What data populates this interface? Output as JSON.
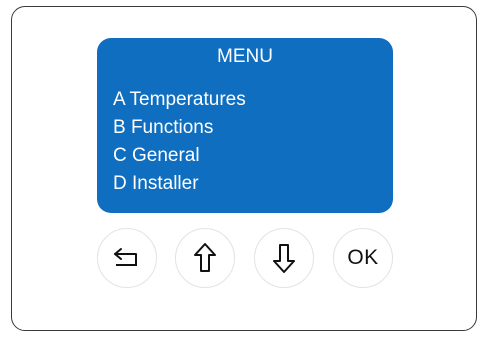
{
  "screen": {
    "title": "MENU",
    "items": [
      {
        "label": "A Temperatures"
      },
      {
        "label": "B Functions"
      },
      {
        "label": "C General"
      },
      {
        "label": "D Installer"
      }
    ],
    "background_color": "#0f6ebf",
    "text_color": "#ffffff"
  },
  "buttons": {
    "back_icon": "return-arrow-icon",
    "up_icon": "arrow-up-icon",
    "down_icon": "arrow-down-icon",
    "ok_label": "OK"
  }
}
